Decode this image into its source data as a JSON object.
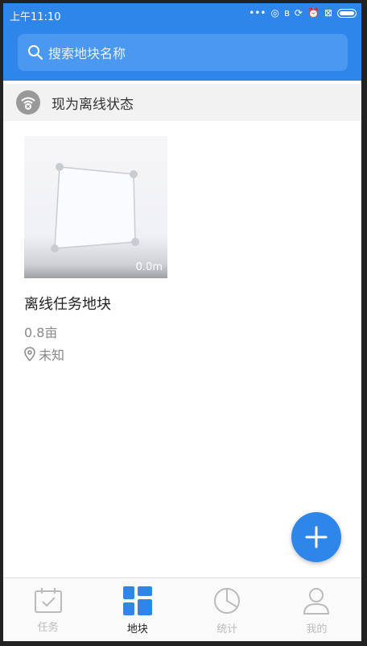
{
  "status_bar": {
    "time": "上午11:10",
    "icons": [
      "more-dots-icon",
      "target-icon",
      "bluetooth-icon",
      "rotate-icon",
      "alarm-icon",
      "close-box-icon",
      "battery-icon"
    ]
  },
  "search": {
    "placeholder": "搜索地块名称"
  },
  "offline": {
    "text": "现为离线状态"
  },
  "plot": {
    "area_label": "0.0m",
    "name": "离线任务地块",
    "size": "0.8亩",
    "location": "未知"
  },
  "nav": {
    "tabs": [
      {
        "label": "任务",
        "icon": "calendar-check-icon",
        "active": false
      },
      {
        "label": "地块",
        "icon": "grid-blocks-icon",
        "active": true
      },
      {
        "label": "统计",
        "icon": "pie-chart-icon",
        "active": false
      },
      {
        "label": "我的",
        "icon": "person-icon",
        "active": false
      }
    ]
  },
  "colors": {
    "accent": "#2f86ea",
    "inactive": "#bbbbbb"
  }
}
